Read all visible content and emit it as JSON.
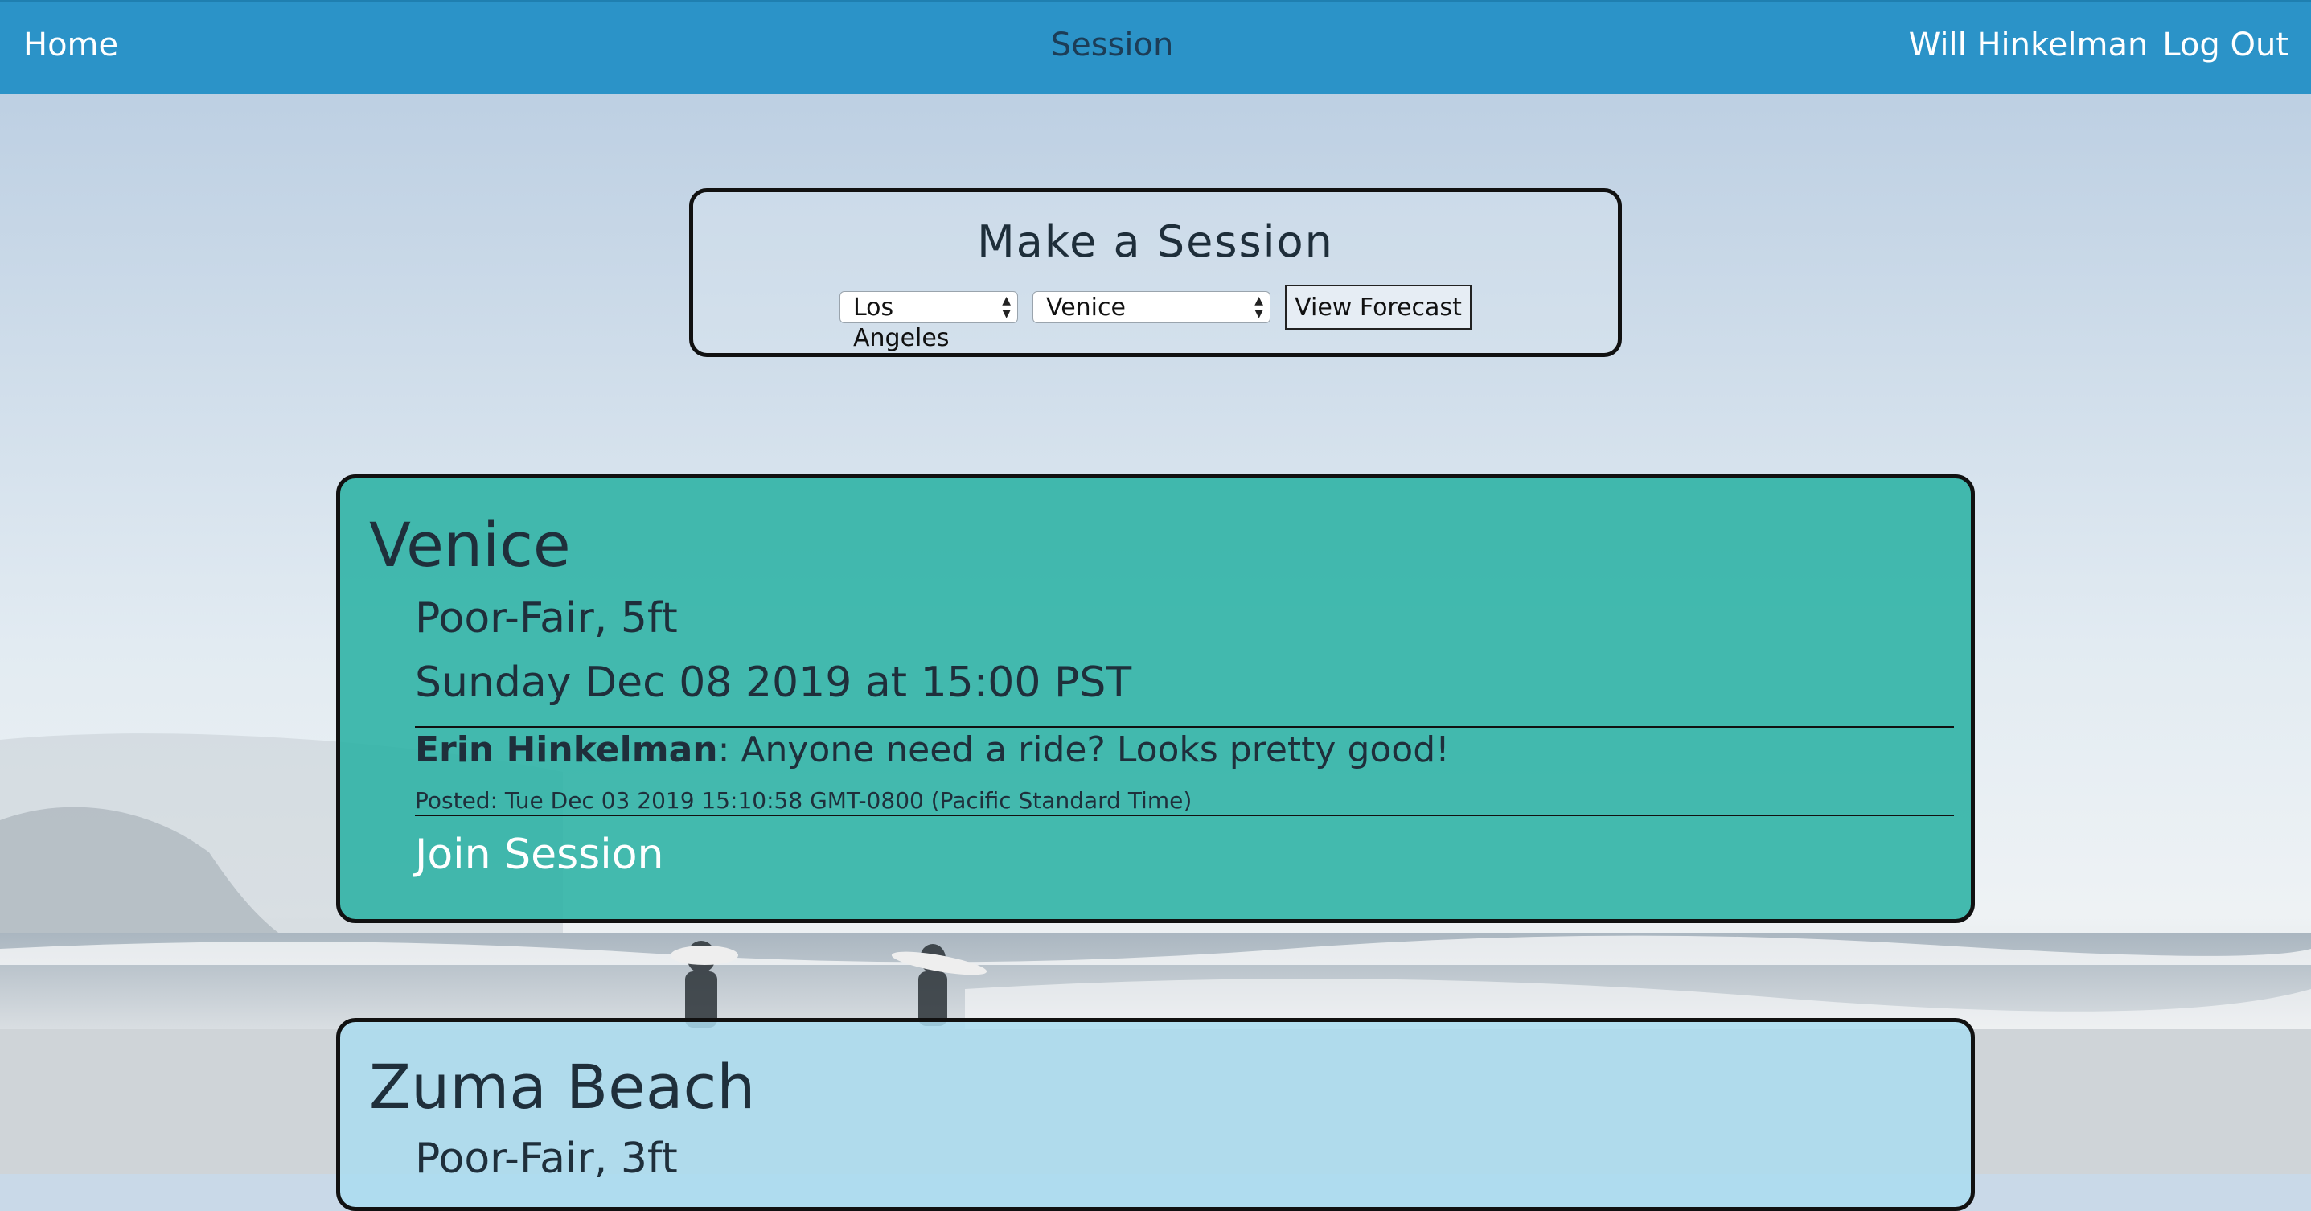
{
  "nav": {
    "home_label": "Home",
    "title": "Session",
    "user_name": "Will Hinkelman",
    "logout_label": "Log Out"
  },
  "make_session": {
    "title": "Make a Session",
    "city_selected": "Los Angeles",
    "spot_selected": "Venice",
    "forecast_button": "View Forecast"
  },
  "sessions": [
    {
      "spot": "Venice",
      "conditions": "Poor-Fair, 5ft",
      "time": "Sunday Dec 08 2019 at 15:00 PST",
      "comment_author": "Erin Hinkelman",
      "comment_sep": ":",
      "comment_text": " Anyone need a ride? Looks pretty good!",
      "comment_posted": "Posted: Tue Dec 03 2019 15:10:58 GMT-0800 (Pacific Standard Time)",
      "join_label": "Join Session"
    },
    {
      "spot": "Zuma Beach",
      "conditions": "Poor-Fair, 3ft"
    }
  ],
  "colors": {
    "nav_bg": "#2b93c8",
    "card_active": "#2bb2a4",
    "card_inactive": "#aadcf0"
  }
}
